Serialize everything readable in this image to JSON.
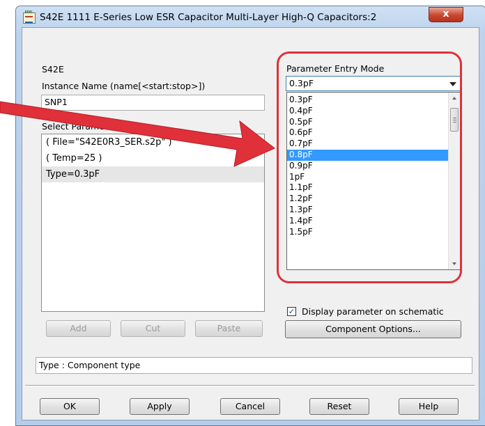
{
  "window": {
    "title": "S42E 1111 E-Series Low ESR Capacitor Multi-Layer High-Q Capacitors:2",
    "close_glyph": "x"
  },
  "component_name": "S42E",
  "instance": {
    "label": "Instance Name  (name[<start:stop>])",
    "value": "SNP1"
  },
  "select_params": {
    "label_partial": "Select Parame",
    "items": [
      "( File=\"S42E0R3_SER.s2p\" )",
      "( Temp=25 )",
      "Type=0.3pF"
    ],
    "selected_index": 2
  },
  "list_buttons": {
    "add": "Add",
    "cut": "Cut",
    "paste": "Paste"
  },
  "parameter_entry": {
    "label": "Parameter Entry Mode",
    "selected": "0.3pF",
    "options": [
      "0.3pF",
      "0.4pF",
      "0.5pF",
      "0.6pF",
      "0.7pF",
      "0.8pF",
      "0.9pF",
      "1pF",
      "1.1pF",
      "1.2pF",
      "1.3pF",
      "1.4pF",
      "1.5pF"
    ],
    "highlighted": "0.8pF"
  },
  "display_checkbox": {
    "label": "Display parameter on schematic",
    "checked": true,
    "check_glyph": "✓"
  },
  "component_options_label": "Component Options...",
  "status_text": "Type : Component type",
  "footer": {
    "ok": "OK",
    "apply": "Apply",
    "cancel": "Cancel",
    "reset": "Reset",
    "help": "Help"
  },
  "colors": {
    "annotation_red": "#e0303a",
    "highlight_blue": "#3399ff",
    "titlebar": "#bcd3ee",
    "close_red": "#c9452e"
  }
}
